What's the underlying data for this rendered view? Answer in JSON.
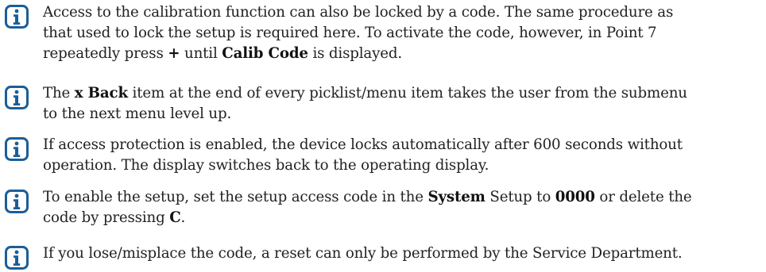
{
  "notes": [
    {
      "icon": "info-icon",
      "lines": [
        [
          {
            "t": "Access to the calibration function can also be locked by a code. The same procedure as",
            "b": false
          }
        ],
        [
          {
            "t": "that used to lock the setup is required here. To activate the code, however, in Point 7",
            "b": false
          }
        ],
        [
          {
            "t": "repeatedly press ",
            "b": false
          },
          {
            "t": "+",
            "b": true
          },
          {
            "t": " until ",
            "b": false
          },
          {
            "t": "Calib Code",
            "b": true
          },
          {
            "t": " is displayed.",
            "b": false
          }
        ]
      ]
    },
    {
      "icon": "info-icon",
      "lines": [
        [
          {
            "t": "The ",
            "b": false
          },
          {
            "t": "x Back",
            "b": true
          },
          {
            "t": " item at the end of every picklist/menu item takes the user from the submenu",
            "b": false
          }
        ],
        [
          {
            "t": "to the next menu level up.",
            "b": false
          }
        ]
      ]
    },
    {
      "icon": "info-icon",
      "lines": [
        [
          {
            "t": "If access protection is enabled, the device locks automatically after 600 seconds without",
            "b": false
          }
        ],
        [
          {
            "t": "operation. The display switches back to the operating display.",
            "b": false
          }
        ]
      ]
    },
    {
      "icon": "info-icon",
      "lines": [
        [
          {
            "t": "To enable the setup, set the setup access code in the ",
            "b": false
          },
          {
            "t": "System",
            "b": true
          },
          {
            "t": " Setup to ",
            "b": false
          },
          {
            "t": "0000",
            "b": true
          },
          {
            "t": " or delete the",
            "b": false
          }
        ],
        [
          {
            "t": "code by pressing ",
            "b": false
          },
          {
            "t": "C",
            "b": true
          },
          {
            "t": ".",
            "b": false
          }
        ]
      ]
    },
    {
      "icon": "info-icon",
      "lines": [
        [
          {
            "t": "If you lose/misplace the code, a reset can only be performed by the Service Department.",
            "b": false
          }
        ]
      ]
    }
  ],
  "colors": {
    "icon_blue": "#1a5e99",
    "text": "#222222"
  }
}
